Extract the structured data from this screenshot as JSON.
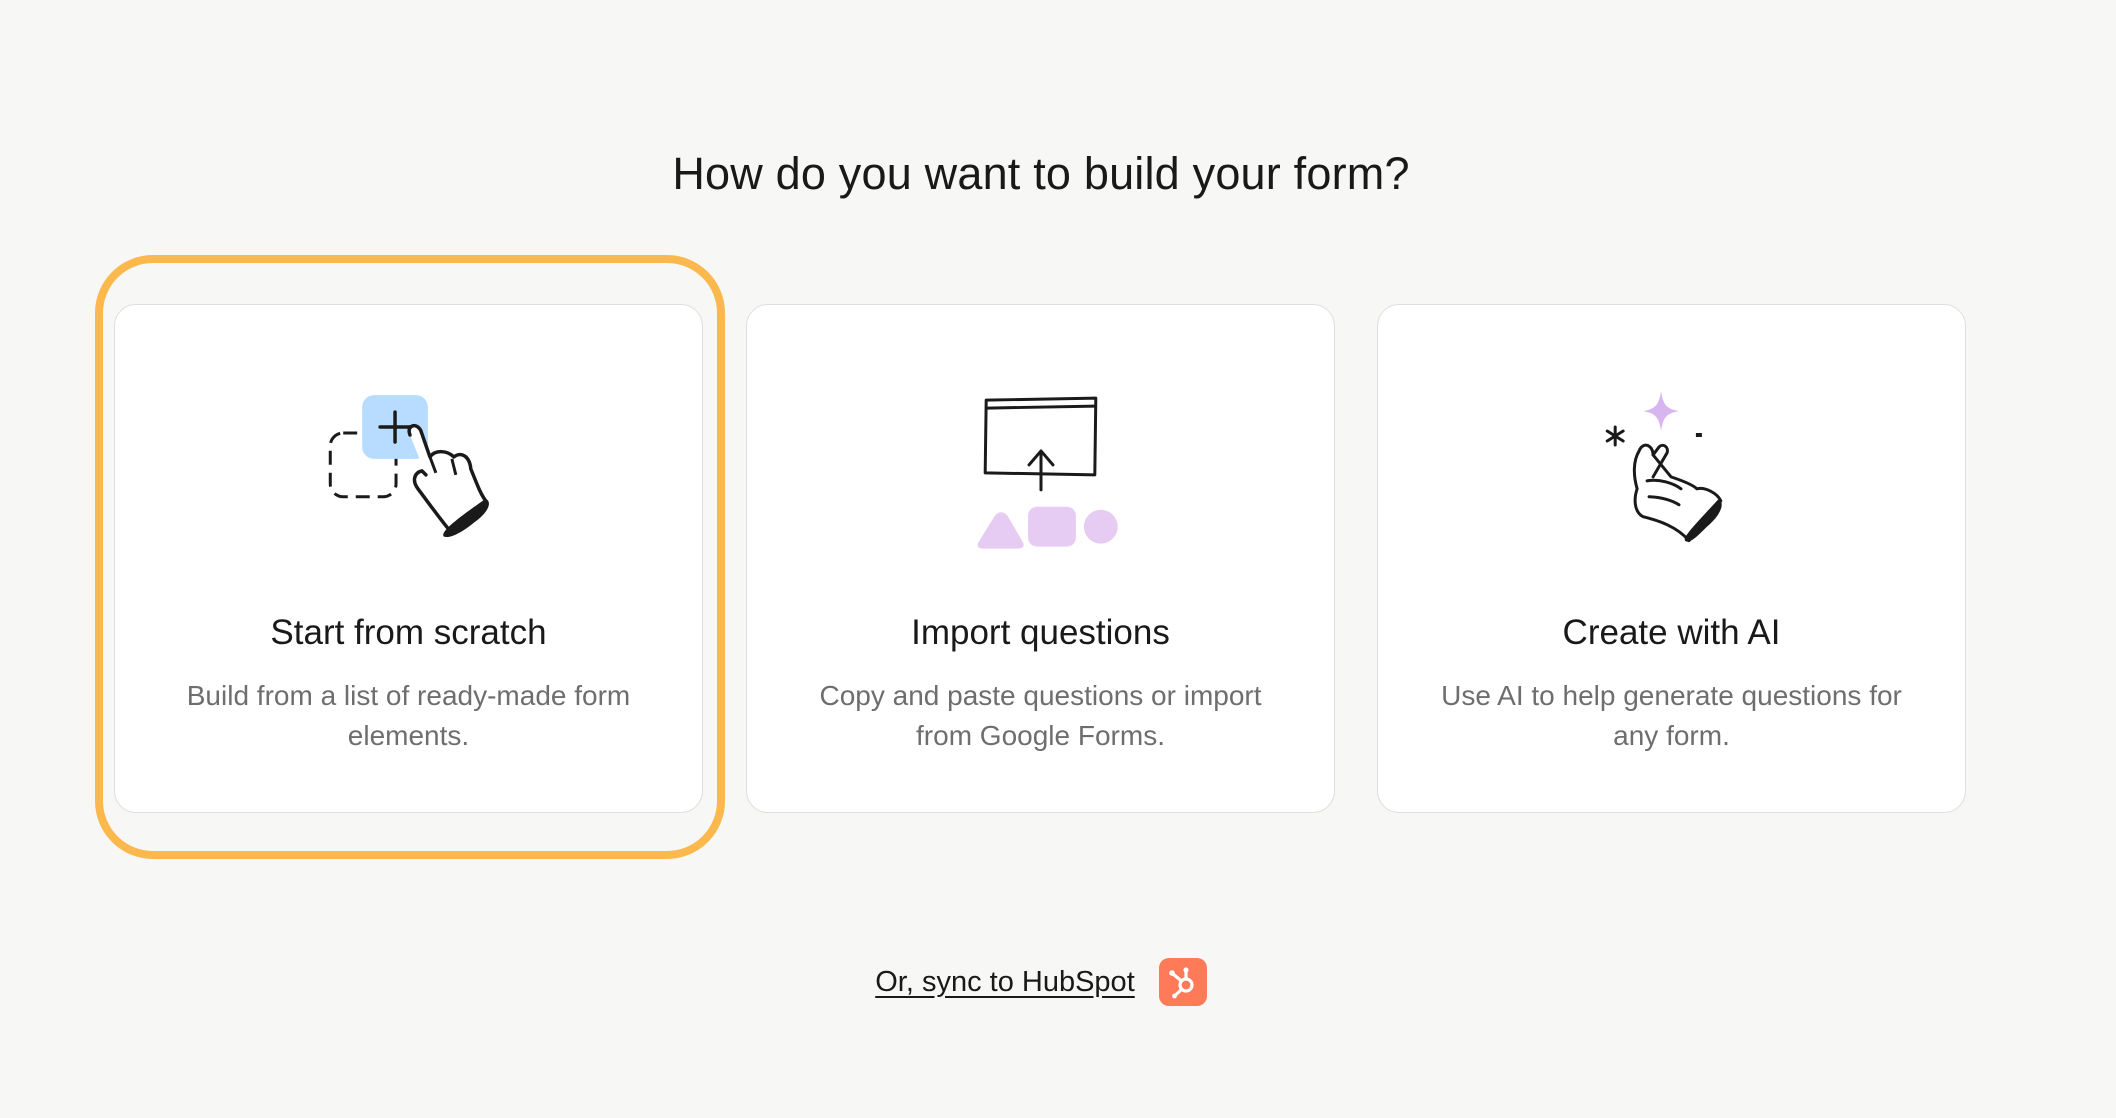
{
  "heading": "How do you want to build your form?",
  "accent_color": "#fbb84d",
  "cards": [
    {
      "title": "Start from scratch",
      "description": "Build from a list of ready-made form elements.",
      "icon": "hand-pointer-plus-icon",
      "highlighted": true
    },
    {
      "title": "Import questions",
      "description": "Copy and paste questions or import from Google Forms.",
      "icon": "upload-shapes-icon",
      "highlighted": false
    },
    {
      "title": "Create with AI",
      "description": "Use AI to help generate questions for any form.",
      "icon": "snapping-hand-sparkle-icon",
      "highlighted": false
    }
  ],
  "sync": {
    "label": "Or, sync to HubSpot",
    "icon": "hubspot-icon",
    "icon_color": "#ff7a59"
  }
}
